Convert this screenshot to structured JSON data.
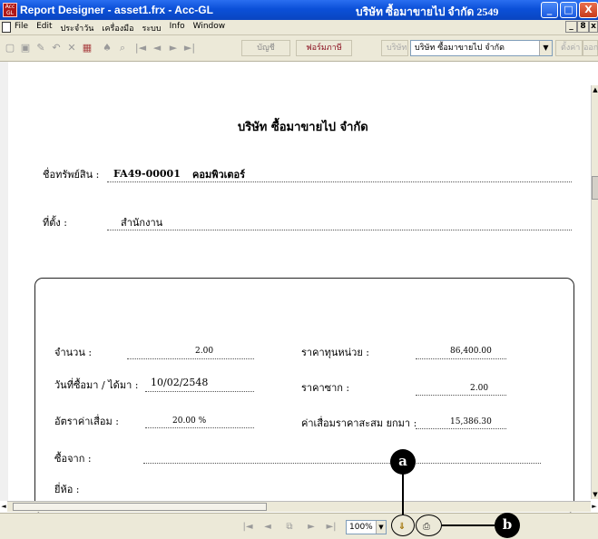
{
  "window": {
    "title": "Report Designer - asset1.frx - Acc-GL",
    "company_title": "บริษัท ซื้อมาขายไป จำกัด  2549",
    "app_icon_text": "Acc GL",
    "buttons": {
      "minimize": "_",
      "maximize": "□",
      "close": "X"
    }
  },
  "menu": {
    "items": [
      "File",
      "Edit",
      "ประจำวัน",
      "เครื่องมือ",
      "ระบบ",
      "Info",
      "Window"
    ],
    "mdi_buttons": {
      "minimize": "_",
      "restore": "8",
      "close": "x"
    }
  },
  "toolbar": {
    "btn_ledger": "บัญชี",
    "btn_form": "ฟอร์มภาษี",
    "btn_company": "บริษัท",
    "company_combo_value": "บริษัท ซื้อมาขายไป จำกัด",
    "btn_setup": "ตั้งค่า",
    "btn_more": "ออก"
  },
  "report": {
    "heading": "บริษัท ซื้อมาขายไป จำกัด",
    "asset_name_label": "ชื่อทรัพย์สิน :",
    "asset_code": "FA49-00001",
    "asset_name": "คอมพิวเตอร์",
    "location_label": "ที่ตั้ง :",
    "location_value": "สำนักงาน",
    "quantity_label": "จำนวน :",
    "quantity_value": "2.00",
    "unit_cost_label": "ราคาทุนหน่วย :",
    "unit_cost_value": "86,400.00",
    "acquired_date_label": "วันที่ซื้อมา / ได้มา :",
    "acquired_date_value": "10/02/2548",
    "salvage_label": "ราคาซาก :",
    "salvage_value": "2.00",
    "depr_rate_label": "อัตราค่าเสื่อม :",
    "depr_rate_value": "20.00 %",
    "accum_depr_label": "ค่าเสื่อมราคาสะสม ยกมา :",
    "accum_depr_value": "15,386.30",
    "bought_from_label": "ซื้อจาก :",
    "brand_label": "ยี่ห้อ :"
  },
  "navigation": {
    "first": "|◄",
    "prev": "◄",
    "next": "►",
    "last": "►|",
    "zoom": "100%"
  },
  "callouts": {
    "a": "a",
    "b": "b"
  }
}
